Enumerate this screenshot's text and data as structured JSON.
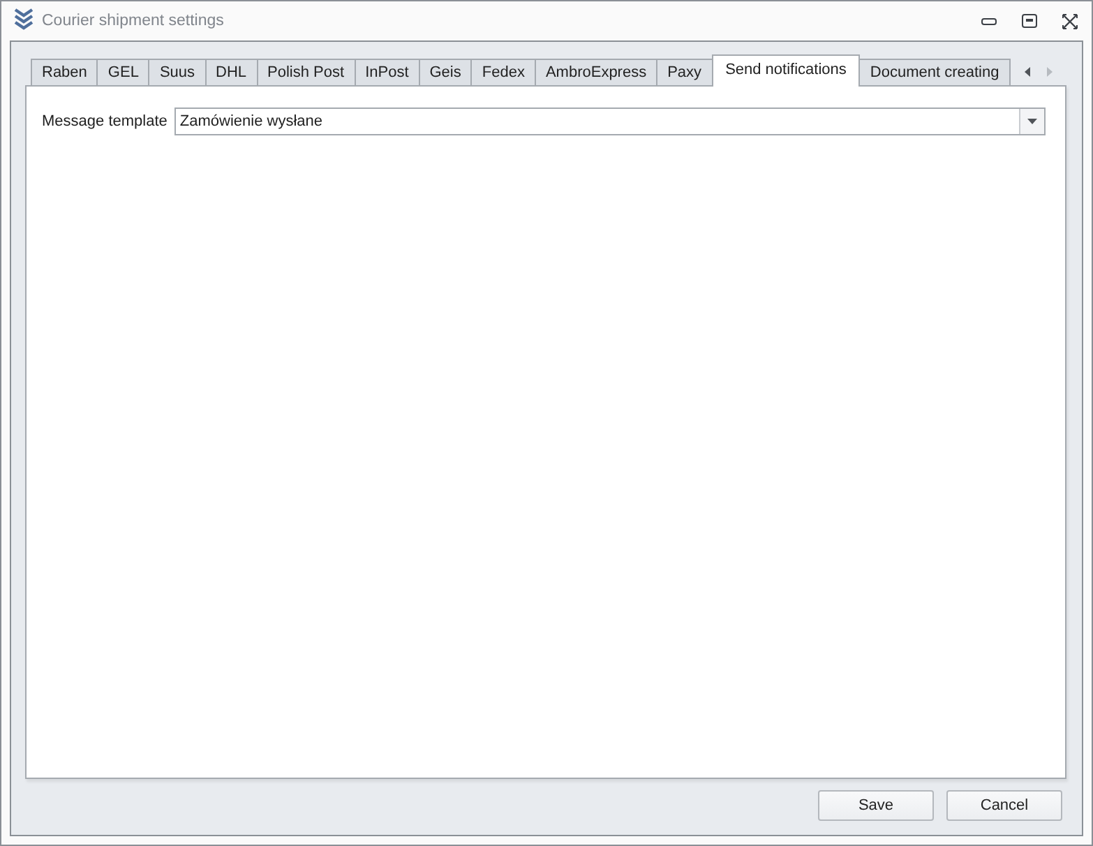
{
  "window": {
    "title": "Courier shipment settings"
  },
  "tabs": [
    {
      "label": "Raben",
      "selected": false
    },
    {
      "label": "GEL",
      "selected": false
    },
    {
      "label": "Suus",
      "selected": false
    },
    {
      "label": "DHL",
      "selected": false
    },
    {
      "label": "Polish Post",
      "selected": false
    },
    {
      "label": "InPost",
      "selected": false
    },
    {
      "label": "Geis",
      "selected": false
    },
    {
      "label": "Fedex",
      "selected": false
    },
    {
      "label": "AmbroExpress",
      "selected": false
    },
    {
      "label": "Paxy",
      "selected": false
    },
    {
      "label": "Send notifications",
      "selected": true
    },
    {
      "label": "Document creating",
      "selected": false
    }
  ],
  "tab_scroll": {
    "previous_disabled": false,
    "next_disabled": true
  },
  "form": {
    "label": "Message template",
    "value": "Zamówienie wysłane"
  },
  "buttons": [
    {
      "label": "Save"
    },
    {
      "label": "Cancel"
    }
  ]
}
